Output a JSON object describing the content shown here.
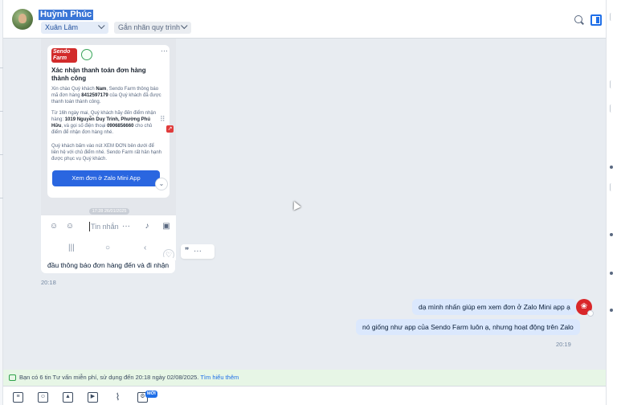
{
  "header": {
    "contact_name": "Huỳnh Phúc",
    "account_select": "Xuân Lâm",
    "tag_select": "Gắn nhãn quy trình"
  },
  "screenshot": {
    "brand_line1": "Sendo",
    "brand_line2": "Farm",
    "more": "···",
    "card_title": "Xác nhận thanh toán đơn hàng thành công",
    "para1_a": "Xin chào Quý khách ",
    "para1_b": "Nam",
    "para1_c": ", Sendo Farm thông báo mã đơn hàng ",
    "para1_d": "8412597179",
    "para1_e": " của Quý khách đã được thanh toán thành công.",
    "para2_a": "Từ 16h ngày mai, Quý khách hãy đến điểm nhận hàng: ",
    "para2_b": "1019 Nguyễn Duy Trinh, Phường Phú Hữu",
    "para2_c": ", và gọi số điện thoại ",
    "para2_d": "0906856660",
    "para2_e": " cho chủ điểm để nhận đơn hàng nhé.",
    "para3": "Quý khách bấm vào nút XEM ĐƠN bên dưới để liên hệ với chủ điểm nhé. Sendo Farm rất hân hạnh được phục vụ Quý khách.",
    "button_label": "Xem đơn ở Zalo Mini App",
    "timestamp": "17:28 26/01/2025",
    "input_placeholder": "Tin nhắn"
  },
  "messages": [
    {
      "text": "đầu thông báo đơn hàng đến và đi nhận",
      "time": "20:18"
    },
    {
      "text": "dạ mình nhấn giúp em xem đơn ở Zalo Mini app ạ"
    },
    {
      "text": "nó giống như app của Sendo Farm luôn ạ, nhưng hoạt động trên Zalo",
      "time": "20:19"
    }
  ],
  "notice": {
    "text": "Bạn có 6 tin Tư vấn miễn phí, sử dụng đến 20:18 ngày 02/08/2025. ",
    "link": "Tìm hiểu thêm"
  },
  "toolbar": {
    "new_badge": "MỚI",
    "icons": [
      "message-template-icon",
      "sticker-icon",
      "image-icon",
      "video-icon",
      "attachment-icon",
      "mini-app-icon"
    ]
  },
  "colors": {
    "accent": "#1f6fe8",
    "outgoing_bubble": "#dbe8fd",
    "notice_bg": "#e7f6e6",
    "sendo_red": "#d22b2b"
  }
}
